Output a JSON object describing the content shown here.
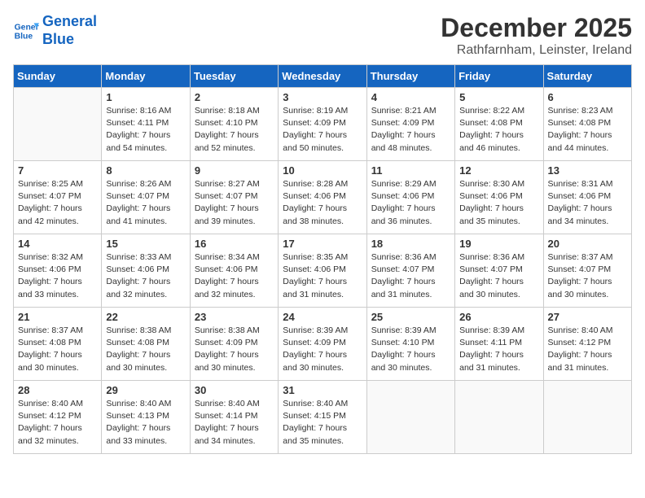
{
  "header": {
    "logo_line1": "General",
    "logo_line2": "Blue",
    "month": "December 2025",
    "location": "Rathfarnham, Leinster, Ireland"
  },
  "weekdays": [
    "Sunday",
    "Monday",
    "Tuesday",
    "Wednesday",
    "Thursday",
    "Friday",
    "Saturday"
  ],
  "weeks": [
    [
      {
        "day": "",
        "info": ""
      },
      {
        "day": "1",
        "info": "Sunrise: 8:16 AM\nSunset: 4:11 PM\nDaylight: 7 hours\nand 54 minutes."
      },
      {
        "day": "2",
        "info": "Sunrise: 8:18 AM\nSunset: 4:10 PM\nDaylight: 7 hours\nand 52 minutes."
      },
      {
        "day": "3",
        "info": "Sunrise: 8:19 AM\nSunset: 4:09 PM\nDaylight: 7 hours\nand 50 minutes."
      },
      {
        "day": "4",
        "info": "Sunrise: 8:21 AM\nSunset: 4:09 PM\nDaylight: 7 hours\nand 48 minutes."
      },
      {
        "day": "5",
        "info": "Sunrise: 8:22 AM\nSunset: 4:08 PM\nDaylight: 7 hours\nand 46 minutes."
      },
      {
        "day": "6",
        "info": "Sunrise: 8:23 AM\nSunset: 4:08 PM\nDaylight: 7 hours\nand 44 minutes."
      }
    ],
    [
      {
        "day": "7",
        "info": "Sunrise: 8:25 AM\nSunset: 4:07 PM\nDaylight: 7 hours\nand 42 minutes."
      },
      {
        "day": "8",
        "info": "Sunrise: 8:26 AM\nSunset: 4:07 PM\nDaylight: 7 hours\nand 41 minutes."
      },
      {
        "day": "9",
        "info": "Sunrise: 8:27 AM\nSunset: 4:07 PM\nDaylight: 7 hours\nand 39 minutes."
      },
      {
        "day": "10",
        "info": "Sunrise: 8:28 AM\nSunset: 4:06 PM\nDaylight: 7 hours\nand 38 minutes."
      },
      {
        "day": "11",
        "info": "Sunrise: 8:29 AM\nSunset: 4:06 PM\nDaylight: 7 hours\nand 36 minutes."
      },
      {
        "day": "12",
        "info": "Sunrise: 8:30 AM\nSunset: 4:06 PM\nDaylight: 7 hours\nand 35 minutes."
      },
      {
        "day": "13",
        "info": "Sunrise: 8:31 AM\nSunset: 4:06 PM\nDaylight: 7 hours\nand 34 minutes."
      }
    ],
    [
      {
        "day": "14",
        "info": "Sunrise: 8:32 AM\nSunset: 4:06 PM\nDaylight: 7 hours\nand 33 minutes."
      },
      {
        "day": "15",
        "info": "Sunrise: 8:33 AM\nSunset: 4:06 PM\nDaylight: 7 hours\nand 32 minutes."
      },
      {
        "day": "16",
        "info": "Sunrise: 8:34 AM\nSunset: 4:06 PM\nDaylight: 7 hours\nand 32 minutes."
      },
      {
        "day": "17",
        "info": "Sunrise: 8:35 AM\nSunset: 4:06 PM\nDaylight: 7 hours\nand 31 minutes."
      },
      {
        "day": "18",
        "info": "Sunrise: 8:36 AM\nSunset: 4:07 PM\nDaylight: 7 hours\nand 31 minutes."
      },
      {
        "day": "19",
        "info": "Sunrise: 8:36 AM\nSunset: 4:07 PM\nDaylight: 7 hours\nand 30 minutes."
      },
      {
        "day": "20",
        "info": "Sunrise: 8:37 AM\nSunset: 4:07 PM\nDaylight: 7 hours\nand 30 minutes."
      }
    ],
    [
      {
        "day": "21",
        "info": "Sunrise: 8:37 AM\nSunset: 4:08 PM\nDaylight: 7 hours\nand 30 minutes."
      },
      {
        "day": "22",
        "info": "Sunrise: 8:38 AM\nSunset: 4:08 PM\nDaylight: 7 hours\nand 30 minutes."
      },
      {
        "day": "23",
        "info": "Sunrise: 8:38 AM\nSunset: 4:09 PM\nDaylight: 7 hours\nand 30 minutes."
      },
      {
        "day": "24",
        "info": "Sunrise: 8:39 AM\nSunset: 4:09 PM\nDaylight: 7 hours\nand 30 minutes."
      },
      {
        "day": "25",
        "info": "Sunrise: 8:39 AM\nSunset: 4:10 PM\nDaylight: 7 hours\nand 30 minutes."
      },
      {
        "day": "26",
        "info": "Sunrise: 8:39 AM\nSunset: 4:11 PM\nDaylight: 7 hours\nand 31 minutes."
      },
      {
        "day": "27",
        "info": "Sunrise: 8:40 AM\nSunset: 4:12 PM\nDaylight: 7 hours\nand 31 minutes."
      }
    ],
    [
      {
        "day": "28",
        "info": "Sunrise: 8:40 AM\nSunset: 4:12 PM\nDaylight: 7 hours\nand 32 minutes."
      },
      {
        "day": "29",
        "info": "Sunrise: 8:40 AM\nSunset: 4:13 PM\nDaylight: 7 hours\nand 33 minutes."
      },
      {
        "day": "30",
        "info": "Sunrise: 8:40 AM\nSunset: 4:14 PM\nDaylight: 7 hours\nand 34 minutes."
      },
      {
        "day": "31",
        "info": "Sunrise: 8:40 AM\nSunset: 4:15 PM\nDaylight: 7 hours\nand 35 minutes."
      },
      {
        "day": "",
        "info": ""
      },
      {
        "day": "",
        "info": ""
      },
      {
        "day": "",
        "info": ""
      }
    ]
  ]
}
